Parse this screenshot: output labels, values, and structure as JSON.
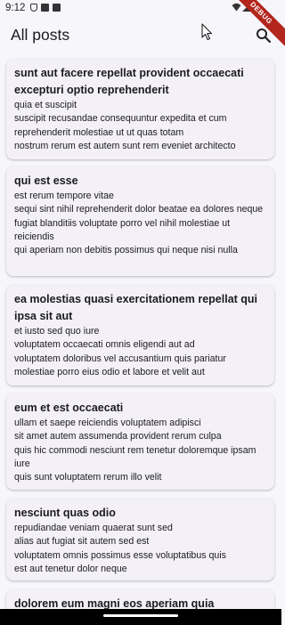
{
  "status_bar": {
    "time": "9:12",
    "icons": [
      "shield-icon",
      "sim-card-icon",
      "apk-icon",
      "wifi-icon",
      "signal-icon",
      "battery-icon"
    ]
  },
  "debug_banner": "DEBUG",
  "app_bar": {
    "title": "All posts",
    "search_icon": "search-icon"
  },
  "colors": {
    "background": "#f7f6fb",
    "card": "#f3f1f7",
    "debug": "#b3261e"
  },
  "posts": [
    {
      "title": "sunt aut facere repellat provident occaecati excepturi optio reprehenderit",
      "body": "quia et suscipit\nsuscipit recusandae consequuntur expedita et cum reprehenderit molestiae ut ut quas totam\nnostrum rerum est autem sunt rem eveniet architecto"
    },
    {
      "title": "qui est esse",
      "body": "est rerum tempore vitae\nsequi sint nihil reprehenderit dolor beatae ea dolores neque\nfugiat blanditiis voluptate porro vel nihil molestiae ut reiciendis\nqui aperiam non debitis possimus qui neque nisi nulla"
    },
    {
      "title": "ea molestias quasi exercitationem repellat qui ipsa sit aut",
      "body": "et iusto sed quo iure\nvoluptatem occaecati omnis eligendi aut ad\nvoluptatem doloribus vel accusantium quis pariatur\nmolestiae porro eius odio et labore et velit aut"
    },
    {
      "title": "eum et est occaecati",
      "body": "ullam et saepe reiciendis voluptatem adipisci\nsit amet autem assumenda provident rerum culpa\nquis hic commodi nesciunt rem tenetur doloremque ipsam iure\nquis sunt voluptatem rerum illo velit"
    },
    {
      "title": "nesciunt quas odio",
      "body": "repudiandae veniam quaerat sunt sed\nalias aut fugiat sit autem sed est\nvoluptatem omnis possimus esse voluptatibus quis\nest aut tenetur dolor neque"
    },
    {
      "title": "dolorem eum magni eos aperiam quia",
      "body": ""
    }
  ]
}
